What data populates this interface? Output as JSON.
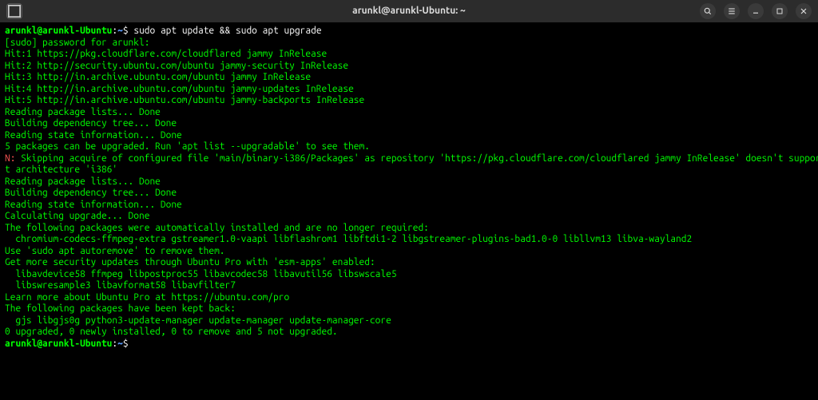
{
  "window": {
    "title": "arunkl@arunkl-Ubuntu: ~"
  },
  "prompt": {
    "user_host": "arunkl@arunkl-Ubuntu",
    "sep": ":",
    "path": "~",
    "symbol": "$"
  },
  "command": "sudo apt update && sudo apt upgrade",
  "lines": {
    "l01": "[sudo] password for arunkl:",
    "l02": "Hit:1 https://pkg.cloudflare.com/cloudflared jammy InRelease",
    "l03": "Hit:2 http://security.ubuntu.com/ubuntu jammy-security InRelease",
    "l04": "Hit:3 http://in.archive.ubuntu.com/ubuntu jammy InRelease",
    "l05": "Hit:4 http://in.archive.ubuntu.com/ubuntu jammy-updates InRelease",
    "l06": "Hit:5 http://in.archive.ubuntu.com/ubuntu jammy-backports InRelease",
    "l07": "Reading package lists... Done",
    "l08": "Building dependency tree... Done",
    "l09": "Reading state information... Done",
    "l10": "5 packages can be upgraded. Run 'apt list --upgradable' to see them.",
    "l11_a": "N:",
    "l11_b": " Skipping acquire of configured file 'main/binary-i386/Packages' as repository 'https://pkg.cloudflare.com/cloudflared jammy InRelease' doesn't suppor",
    "l11_c": "t architecture 'i386'",
    "l12": "Reading package lists... Done",
    "l13": "Building dependency tree... Done",
    "l14": "Reading state information... Done",
    "l15": "Calculating upgrade... Done",
    "l16": "The following packages were automatically installed and are no longer required:",
    "l17": "  chromium-codecs-ffmpeg-extra gstreamer1.0-vaapi libflashrom1 libftdi1-2 libgstreamer-plugins-bad1.0-0 libllvm13 libva-wayland2",
    "l18": "Use 'sudo apt autoremove' to remove them.",
    "l19": "Get more security updates through Ubuntu Pro with 'esm-apps' enabled:",
    "l20": "  libavdevice58 ffmpeg libpostproc55 libavcodec58 libavutil56 libswscale5",
    "l21": "  libswresample3 libavformat58 libavfilter7",
    "l22": "Learn more about Ubuntu Pro at https://ubuntu.com/pro",
    "l23": "The following packages have been kept back:",
    "l24": "  gjs libgjs0g python3-update-manager update-manager update-manager-core",
    "l25": "0 upgraded, 0 newly installed, 0 to remove and 5 not upgraded."
  }
}
